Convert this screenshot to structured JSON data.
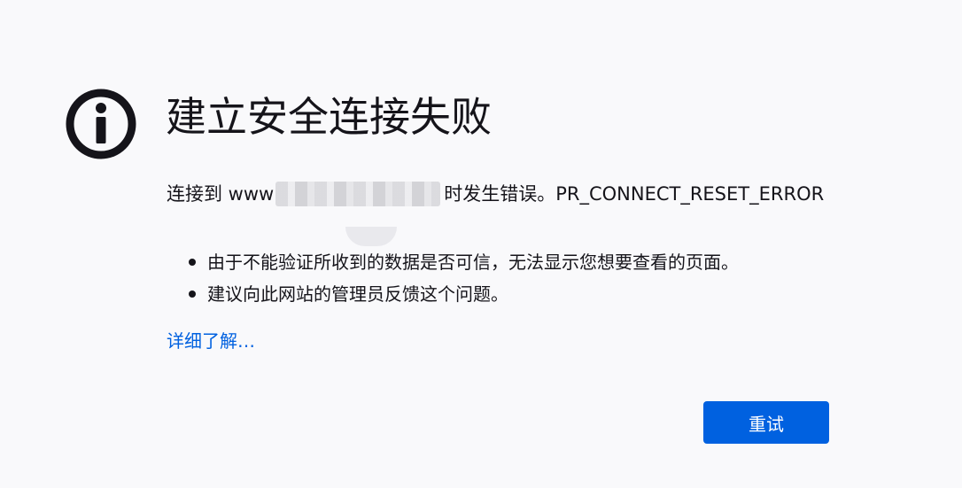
{
  "page": {
    "icon": "info-icon",
    "title": "建立安全连接失败"
  },
  "error": {
    "prefix": "连接到 www",
    "suffix": "时发生错误。PR_CONNECT_RESET_ERROR",
    "code": "PR_CONNECT_RESET_ERROR"
  },
  "bullets": [
    "由于不能验证所收到的数据是否可信，无法显示您想要查看的页面。",
    "建议向此网站的管理员反馈这个问题。"
  ],
  "links": {
    "learn_more": "详细了解…"
  },
  "actions": {
    "retry_label": "重试"
  },
  "colors": {
    "background": "#f9f9fb",
    "text": "#15141a",
    "accent": "#0061e0",
    "button_text": "#ffffff"
  }
}
